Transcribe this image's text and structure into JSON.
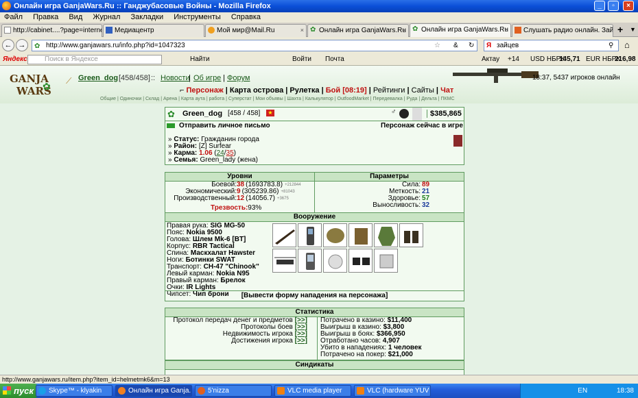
{
  "window": {
    "title": "Онлайн игра GanjaWars.Ru :: Ганджубасовые Войны - Mozilla Firefox"
  },
  "menu": [
    "Файл",
    "Правка",
    "Вид",
    "Журнал",
    "Закладки",
    "Инструменты",
    "Справка"
  ],
  "tabs": [
    {
      "label": "http://cabinet....?page=internet"
    },
    {
      "label": "Медиацентр"
    },
    {
      "label": "Мой мир@Mail.Ru"
    },
    {
      "label": "Онлайн игра GanjaWars.Ru ::..."
    },
    {
      "label": "Онлайн игра GanjaWars.Ru ::..."
    },
    {
      "label": "Слушать радио онлайн. Зайц..."
    }
  ],
  "nav": {
    "url": "http://www.ganjawars.ru/info.php?id=1047323",
    "search_value": "зайцев"
  },
  "yandex": {
    "brand": "Яндекс",
    "search_placeholder": "Поиск в Яндексе",
    "find": "Найти",
    "login": "Войти",
    "mail": "Почта",
    "city": "Актау",
    "temp": "+14",
    "usd_label": "USD НБРК",
    "usd": "145,71",
    "eur_label": "EUR НБРК",
    "eur": "216,98"
  },
  "site": {
    "logo_top": "GANJA",
    "logo_bottom": "WARS",
    "player": "Green_dog",
    "level": "[458/458]",
    "sep": "::",
    "links": [
      "Новости",
      "Об игре",
      "Форум"
    ],
    "time": "18:37, 5437 игроков онлайн",
    "mainmenu": [
      "Персонаж",
      "Карта острова",
      "Рулетка",
      "Бой [08:19]",
      "Рейтинги",
      "Сайты",
      "Чат"
    ],
    "submenu": [
      "Общие",
      "Одиночки",
      "Склад",
      "Арена",
      "Карта аута",
      "работа",
      "Суперстат",
      "Мои объявы",
      "Шахта",
      "Калькулятор",
      "OutfoodMarket",
      "Передевалка",
      "Руда",
      "Дельта",
      "ПКМС"
    ]
  },
  "profile": {
    "name": "Green_dog",
    "level": "[458 / 458]",
    "money": "$385,865",
    "send_msg": "Отправить личное письмо",
    "ingame": "Персонаж сейчас в игре",
    "status_label": "Статус:",
    "status": "Гражданин города",
    "district_label": "Район:",
    "district": "[Z] Surfear",
    "karma_label": "Карма:",
    "karma": "1.06",
    "karma_a": "24",
    "karma_b": "35",
    "family_label": "Семья:",
    "family": "Green_lady (жена)"
  },
  "levels": {
    "title": "Уровни",
    "rows": [
      {
        "label": "Боевой:",
        "value": "38",
        "detail": "(1693783.8)",
        "plus": "+212844"
      },
      {
        "label": "Экономический:",
        "value": "9",
        "detail": "(305239.86)",
        "plus": "+81043"
      },
      {
        "label": "Производственный:",
        "value": "12",
        "detail": "(14056.7)",
        "plus": "+3675"
      }
    ],
    "sober_label": "Трезвость:",
    "sober": "93%"
  },
  "params": {
    "title": "Параметры",
    "rows": [
      {
        "label": "Сила:",
        "value": "89"
      },
      {
        "label": "Меткость:",
        "value": "21"
      },
      {
        "label": "Здоровье:",
        "value": "57"
      },
      {
        "label": "Выносливость:",
        "value": "32"
      }
    ]
  },
  "armament": {
    "title": "Вооружение",
    "items": [
      {
        "label": "Правая рука:",
        "value": "SIG MG-50"
      },
      {
        "label": "Пояс:",
        "value": "Nokia 9500"
      },
      {
        "label": "Голова:",
        "value": "Шлем Mk-6 [BT]"
      },
      {
        "label": "Корпус:",
        "value": "RBR Tactical"
      },
      {
        "label": "Спина:",
        "value": "Маскхалат Hawster"
      },
      {
        "label": "Ноги:",
        "value": "Ботинки SWAT"
      },
      {
        "label": "Транспорт:",
        "value": "CH-47 \"Chinook\""
      },
      {
        "label": "Левый карман:",
        "value": "Nokia N95"
      },
      {
        "label": "Правый карман:",
        "value": "Брелок"
      },
      {
        "label": "Очки:",
        "value": "IR Lights"
      },
      {
        "label": "Чипсет:",
        "value": "Чип брони"
      }
    ],
    "attack": "[Вывести форму нападения на персонажа]"
  },
  "stats": {
    "title": "Статистика",
    "more": "[>>]",
    "left": [
      "Протокол передач денег и предметов",
      "Протоколы боев",
      "Недвижимость игрока",
      "Достижения игрока"
    ],
    "right": [
      {
        "label": "Потрачено в казино:",
        "value": "$11,400"
      },
      {
        "label": "Выигрыш в казино:",
        "value": "$3,800"
      },
      {
        "label": "Выигрыш в боях:",
        "value": "$366,950"
      },
      {
        "label": "Отработано часов:",
        "value": "4,907"
      },
      {
        "label": "Убито в нападениях:",
        "value": "1 человек"
      },
      {
        "label": "Потрачено на покер:",
        "value": "$21,000"
      }
    ]
  },
  "syndicates": {
    "title": "Синдикаты"
  },
  "statusbar": "http://www.ganjawars.ru/item.php?item_id=helmetmk6&m=13",
  "taskbar": {
    "start": "пуск",
    "items": [
      "Skype™ - klyakin",
      "Онлайн игра Ganja...",
      "5'nizza",
      "VLC media player",
      "VLC (hardware YUV ..."
    ],
    "lang": "EN",
    "clock": "18:38"
  },
  "colors": {
    "accent": "#1a5a1a",
    "red": "#c01010"
  }
}
